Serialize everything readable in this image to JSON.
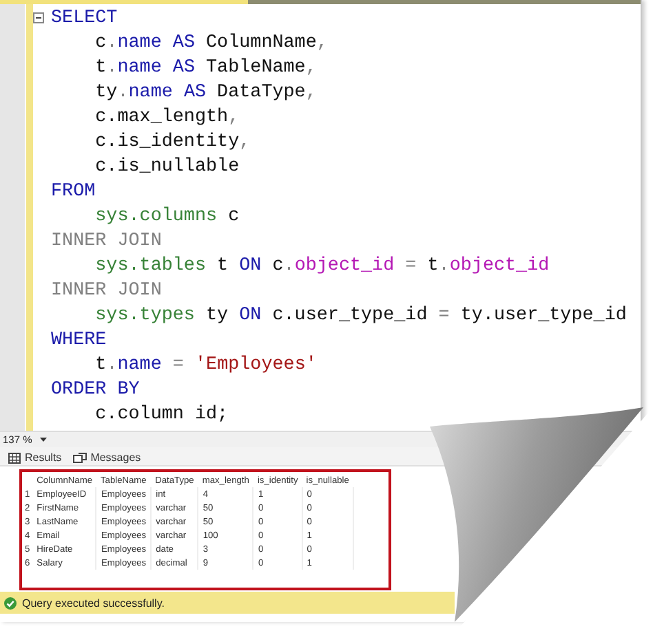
{
  "editor": {
    "lines": [
      {
        "tokens": [
          {
            "text": "SELECT",
            "kind": "kw"
          }
        ]
      },
      {
        "tokens": [
          {
            "text": "    c",
            "kind": "plain"
          },
          {
            "text": ".",
            "kind": "gray"
          },
          {
            "text": "name AS",
            "kind": "kw"
          },
          {
            "text": " ColumnName",
            "kind": "plain"
          },
          {
            "text": ",",
            "kind": "gray"
          }
        ]
      },
      {
        "tokens": [
          {
            "text": "    t",
            "kind": "plain"
          },
          {
            "text": ".",
            "kind": "gray"
          },
          {
            "text": "name AS",
            "kind": "kw"
          },
          {
            "text": " TableName",
            "kind": "plain"
          },
          {
            "text": ",",
            "kind": "gray"
          }
        ]
      },
      {
        "tokens": [
          {
            "text": "    ty",
            "kind": "plain"
          },
          {
            "text": ".",
            "kind": "gray"
          },
          {
            "text": "name AS",
            "kind": "kw"
          },
          {
            "text": " DataType",
            "kind": "plain"
          },
          {
            "text": ",",
            "kind": "gray"
          }
        ]
      },
      {
        "tokens": [
          {
            "text": "    c.max_length",
            "kind": "plain"
          },
          {
            "text": ",",
            "kind": "gray"
          }
        ]
      },
      {
        "tokens": [
          {
            "text": "    c.is_identity",
            "kind": "plain"
          },
          {
            "text": ",",
            "kind": "gray"
          }
        ]
      },
      {
        "tokens": [
          {
            "text": "    c.is_nullable",
            "kind": "plain"
          }
        ]
      },
      {
        "tokens": [
          {
            "text": "FROM",
            "kind": "kw"
          }
        ]
      },
      {
        "tokens": [
          {
            "text": "    sys.columns",
            "kind": "green"
          },
          {
            "text": " c",
            "kind": "plain"
          }
        ]
      },
      {
        "tokens": [
          {
            "text": "INNER JOIN",
            "kind": "gray"
          }
        ]
      },
      {
        "tokens": [
          {
            "text": "    sys.tables",
            "kind": "green"
          },
          {
            "text": " t ",
            "kind": "plain"
          },
          {
            "text": "ON",
            "kind": "kw"
          },
          {
            "text": " c",
            "kind": "plain"
          },
          {
            "text": ".",
            "kind": "gray"
          },
          {
            "text": "object_id",
            "kind": "magenta"
          },
          {
            "text": " = ",
            "kind": "gray"
          },
          {
            "text": "t",
            "kind": "plain"
          },
          {
            "text": ".",
            "kind": "gray"
          },
          {
            "text": "object_id",
            "kind": "magenta"
          }
        ]
      },
      {
        "tokens": [
          {
            "text": "INNER JOIN",
            "kind": "gray"
          }
        ]
      },
      {
        "tokens": [
          {
            "text": "    sys.types",
            "kind": "green"
          },
          {
            "text": " ty ",
            "kind": "plain"
          },
          {
            "text": "ON",
            "kind": "kw"
          },
          {
            "text": " c.user_type_id",
            "kind": "plain"
          },
          {
            "text": " = ",
            "kind": "gray"
          },
          {
            "text": "ty.user_type_id",
            "kind": "plain"
          }
        ]
      },
      {
        "tokens": [
          {
            "text": "WHERE",
            "kind": "kw"
          }
        ]
      },
      {
        "tokens": [
          {
            "text": "    t",
            "kind": "plain"
          },
          {
            "text": ".",
            "kind": "gray"
          },
          {
            "text": "name",
            "kind": "kw"
          },
          {
            "text": " = ",
            "kind": "gray"
          },
          {
            "text": "'Employees'",
            "kind": "string"
          }
        ]
      },
      {
        "tokens": [
          {
            "text": "ORDER BY",
            "kind": "kw"
          }
        ]
      },
      {
        "tokens": [
          {
            "text": "    c.column id;",
            "kind": "plain"
          }
        ]
      }
    ]
  },
  "zoom": "137 %",
  "tabs": [
    {
      "label": "Results",
      "kind": "results"
    },
    {
      "label": "Messages",
      "kind": "messages"
    }
  ],
  "grid": {
    "columns": [
      "ColumnName",
      "TableName",
      "DataType",
      "max_length",
      "is_identity",
      "is_nullable"
    ],
    "rows": [
      {
        "number": "1",
        "cells": [
          "EmployeeID",
          "Employees",
          "int",
          "4",
          "1",
          "0"
        ]
      },
      {
        "number": "2",
        "cells": [
          "FirstName",
          "Employees",
          "varchar",
          "50",
          "0",
          "0"
        ]
      },
      {
        "number": "3",
        "cells": [
          "LastName",
          "Employees",
          "varchar",
          "50",
          "0",
          "0"
        ]
      },
      {
        "number": "4",
        "cells": [
          "Email",
          "Employees",
          "varchar",
          "100",
          "0",
          "1"
        ]
      },
      {
        "number": "5",
        "cells": [
          "HireDate",
          "Employees",
          "date",
          "3",
          "0",
          "0"
        ]
      },
      {
        "number": "6",
        "cells": [
          "Salary",
          "Employees",
          "decimal",
          "9",
          "0",
          "1"
        ]
      }
    ]
  },
  "status": {
    "text": "Query executed successfully."
  }
}
